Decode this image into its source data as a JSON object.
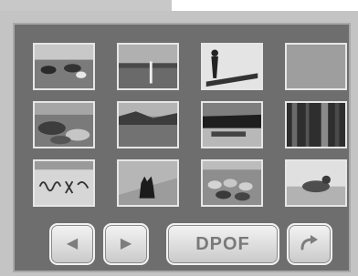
{
  "playback_menu": {
    "thumbnails": [
      {
        "name": "thumbnail-cows-field"
      },
      {
        "name": "thumbnail-lake-sunset"
      },
      {
        "name": "thumbnail-person-on-log"
      },
      {
        "name": "thumbnail-blank-gray"
      },
      {
        "name": "thumbnail-rocky-shore"
      },
      {
        "name": "thumbnail-lake-hills"
      },
      {
        "name": "thumbnail-dark-lake-trees"
      },
      {
        "name": "thumbnail-forest-trees"
      },
      {
        "name": "thumbnail-handwriting-sign"
      },
      {
        "name": "thumbnail-cat-dog"
      },
      {
        "name": "thumbnail-sheep-flock"
      },
      {
        "name": "thumbnail-duck-water"
      }
    ],
    "buttons": {
      "prev_icon": "triangle-left-icon",
      "prev_glyph": "◀",
      "next_icon": "triangle-right-icon",
      "next_glyph": "▶",
      "dpof_label": "DPOF",
      "share_icon": "curved-arrow-right-icon"
    }
  }
}
